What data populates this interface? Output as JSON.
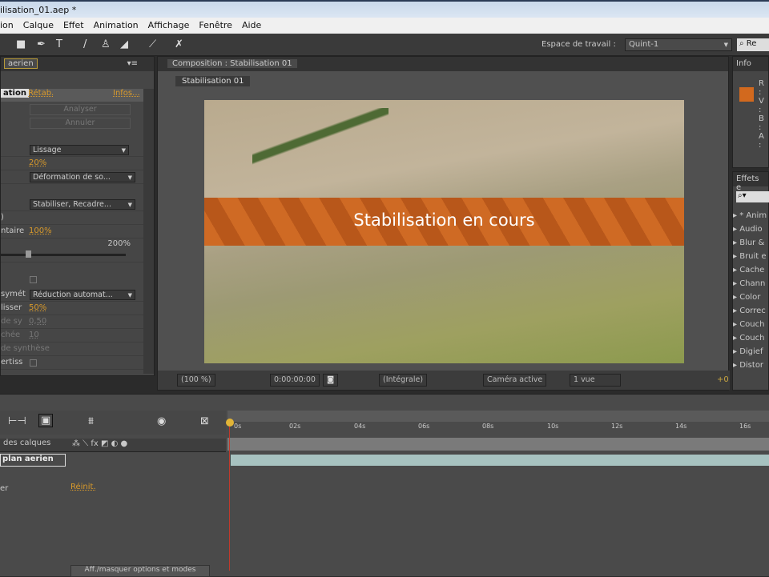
{
  "window": {
    "title": "ilisation_01.aep *"
  },
  "menu": [
    "ion",
    "Calque",
    "Effet",
    "Animation",
    "Affichage",
    "Fenêtre",
    "Aide"
  ],
  "toolbar": {
    "workspace_label": "Espace de travail :",
    "workspace_value": "Quint-1",
    "search": "Re"
  },
  "effects_panel": {
    "tab": "aerien",
    "header": "ation",
    "reset": "Rétab.",
    "info": "Infos...",
    "analyze": "Analyser",
    "cancel": "Annuler",
    "rows": [
      {
        "label": "",
        "dropdown": "Lissage"
      },
      {
        "label": "",
        "value": "20%"
      },
      {
        "label": "",
        "dropdown": "Déformation de so..."
      },
      {
        "label": "",
        "dropdown": "Stabiliser, Recadre..."
      },
      {
        "label": ")"
      },
      {
        "label": "ntaire",
        "value": "100%"
      },
      {
        "label": "",
        "max": "200%"
      },
      {
        "label": "symét",
        "dropdown": "Réduction automat..."
      },
      {
        "label": "lisser",
        "value": "50%"
      },
      {
        "label": "de sy",
        "value": "0,50"
      },
      {
        "label": "chée",
        "value": "10"
      },
      {
        "label": "de synthèse"
      },
      {
        "label": "ertiss"
      }
    ],
    "slider_fraction": 0.15
  },
  "composition": {
    "tab": "Composition : Stabilisation 01",
    "sub_tab": "Stabilisation 01",
    "banner": "Stabilisation en cours",
    "banner_color": "#d2691e",
    "controls": {
      "zoom": "(100 %)",
      "timecode": "0:00:00:00",
      "resolution": "(Intégrale)",
      "camera": "Caméra active",
      "views": "1 vue",
      "exposure": "+0"
    }
  },
  "info_panel": {
    "tab": "Info",
    "labels": [
      "R :",
      "V :",
      "B :",
      "A :"
    ],
    "swatch": "#d2691e"
  },
  "effects_presets": {
    "tab": "Effets e",
    "items": [
      "* Anim",
      "Audio",
      "Blur &",
      "Bruit e",
      "Cache",
      "Chann",
      "Color",
      "Correc",
      "Couch",
      "Couch",
      "Digief",
      "Distor"
    ]
  },
  "timeline": {
    "col_header": "des calques",
    "layer_name": "plan aerien",
    "prop_label": "er",
    "prop_reset": "Réinit.",
    "toggle_button": "Aff./masquer options et modes",
    "ticks": [
      "0s",
      "02s",
      "04s",
      "06s",
      "08s",
      "10s",
      "12s",
      "14s",
      "16s"
    ]
  }
}
